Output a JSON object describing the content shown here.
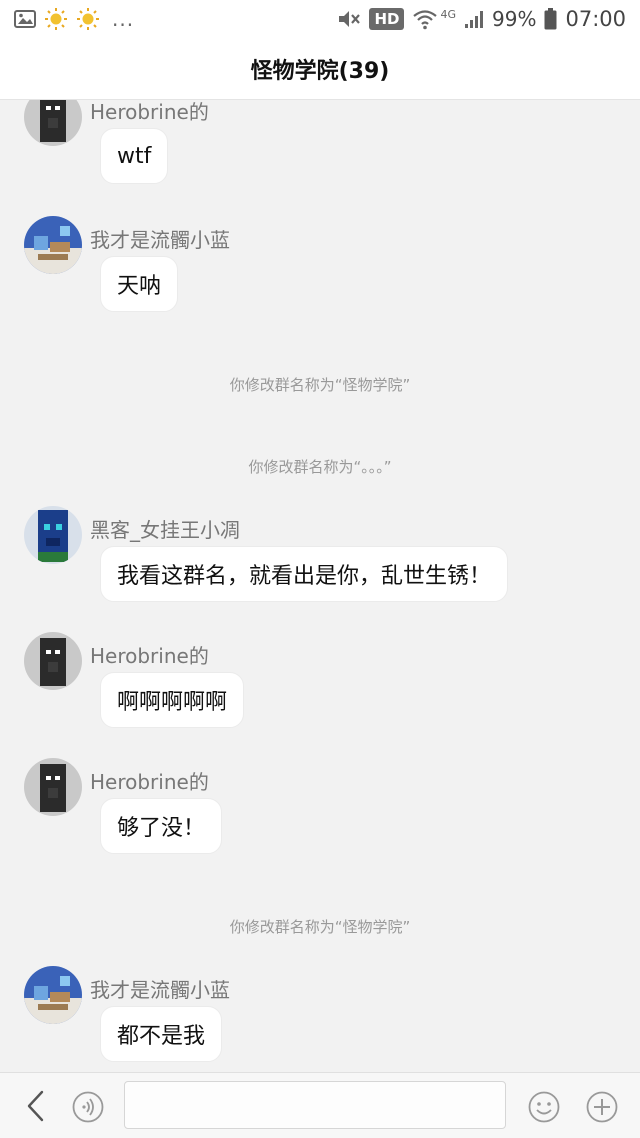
{
  "status_bar": {
    "left_icons": [
      "image-icon",
      "weather-sun-icon",
      "weather-sun-icon"
    ],
    "more_dots": "...",
    "hd_label": "HD",
    "network_label": "4G",
    "battery_percent": "99%",
    "time": "07:00"
  },
  "header": {
    "title": "怪物学院(39)"
  },
  "messages": [
    {
      "type": "user",
      "sender": "Herobrine的",
      "text": "wtf",
      "avatar": "herobrine-avatar"
    },
    {
      "type": "user",
      "sender": "我才是流髑小蓝",
      "text": "天呐",
      "avatar": "blue-avatar"
    },
    {
      "type": "system",
      "text": "你修改群名称为“怪物学院”"
    },
    {
      "type": "system",
      "text": "你修改群名称为“。。。”"
    },
    {
      "type": "user",
      "sender": "黑客_女挂王小凋",
      "text": "我看这群名，就看出是你，乱世生锈！",
      "avatar": "hacker-avatar"
    },
    {
      "type": "user",
      "sender": "Herobrine的",
      "text": "啊啊啊啊啊",
      "avatar": "herobrine-avatar"
    },
    {
      "type": "user",
      "sender": "Herobrine的",
      "text": "够了没！",
      "avatar": "herobrine-avatar"
    },
    {
      "type": "system",
      "text": "你修改群名称为“怪物学院”"
    },
    {
      "type": "user",
      "sender": "我才是流髑小蓝",
      "text": "都不是我",
      "avatar": "blue-avatar"
    }
  ],
  "input_bar": {
    "back_icon": "back-arrow-icon",
    "voice_icon": "voice-icon",
    "input_value": "",
    "emoji_icon": "emoji-icon",
    "plus_icon": "plus-icon"
  },
  "colors": {
    "background": "#f2f2f2",
    "bubble": "#ffffff",
    "sender_text": "#777777",
    "system_text": "#999999"
  }
}
